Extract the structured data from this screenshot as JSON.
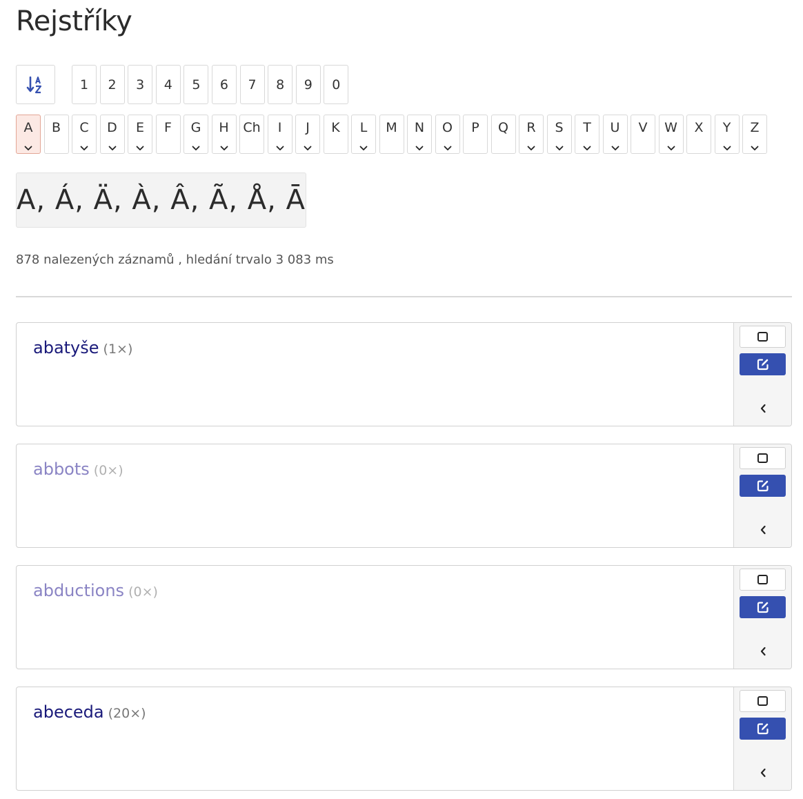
{
  "page": {
    "title": "Rejstříky"
  },
  "sort_icon": "sort-alpha-down-icon",
  "digits": [
    "1",
    "2",
    "3",
    "4",
    "5",
    "6",
    "7",
    "8",
    "9",
    "0"
  ],
  "letters": [
    {
      "label": "A",
      "expandable": true,
      "active": true
    },
    {
      "label": "B",
      "expandable": false
    },
    {
      "label": "C",
      "expandable": true
    },
    {
      "label": "D",
      "expandable": true
    },
    {
      "label": "E",
      "expandable": true
    },
    {
      "label": "F",
      "expandable": false
    },
    {
      "label": "G",
      "expandable": true
    },
    {
      "label": "H",
      "expandable": true
    },
    {
      "label": "Ch",
      "expandable": false
    },
    {
      "label": "I",
      "expandable": true
    },
    {
      "label": "J",
      "expandable": true
    },
    {
      "label": "K",
      "expandable": false
    },
    {
      "label": "L",
      "expandable": true
    },
    {
      "label": "M",
      "expandable": false
    },
    {
      "label": "N",
      "expandable": true
    },
    {
      "label": "O",
      "expandable": true
    },
    {
      "label": "P",
      "expandable": false
    },
    {
      "label": "Q",
      "expandable": false
    },
    {
      "label": "R",
      "expandable": true
    },
    {
      "label": "S",
      "expandable": true
    },
    {
      "label": "T",
      "expandable": true
    },
    {
      "label": "U",
      "expandable": true
    },
    {
      "label": "V",
      "expandable": false
    },
    {
      "label": "W",
      "expandable": true
    },
    {
      "label": "X",
      "expandable": false
    },
    {
      "label": "Y",
      "expandable": true
    },
    {
      "label": "Z",
      "expandable": true
    }
  ],
  "variants": "A, Á, Ä, À, Â, Ã, Å, Ā",
  "stats": "878 nalezených záznamů , hledání trvalo 3 083 ms",
  "entries": [
    {
      "term": "abatyše",
      "count": "(1×)",
      "used": true
    },
    {
      "term": "abbots",
      "count": "(0×)",
      "used": false
    },
    {
      "term": "abductions",
      "count": "(0×)",
      "used": false
    },
    {
      "term": "abeceda",
      "count": "(20×)",
      "used": true
    }
  ],
  "colors": {
    "accent": "#3550b0",
    "active_letter_bg": "#fce9e4",
    "term_used": "#1a1a7a",
    "term_unused": "#8a84c4"
  }
}
